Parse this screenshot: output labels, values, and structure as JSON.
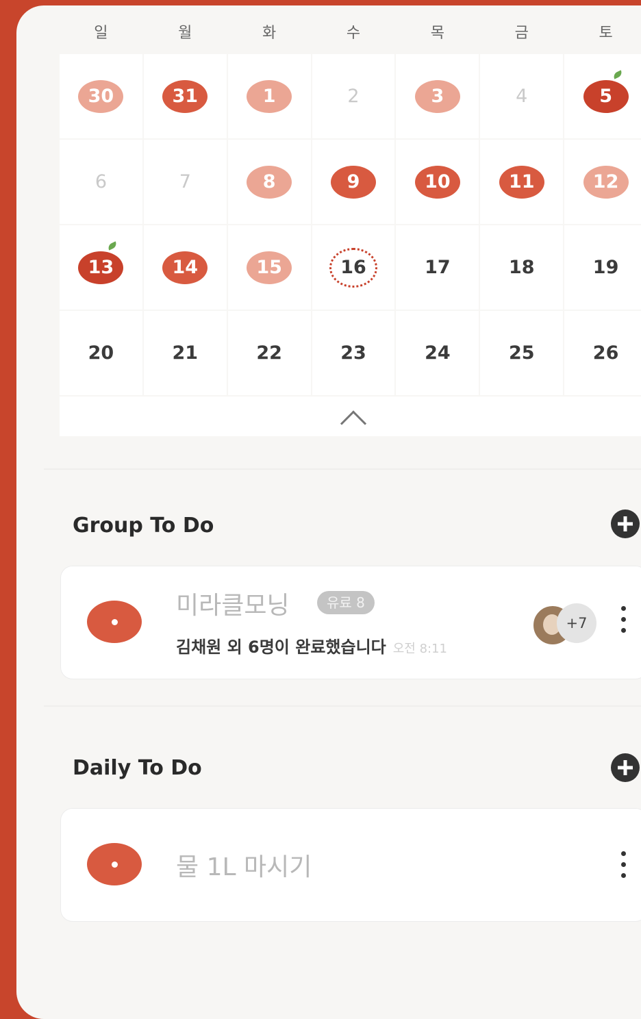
{
  "calendar": {
    "weekdays": [
      "일",
      "월",
      "화",
      "수",
      "목",
      "금",
      "토"
    ],
    "weeks": [
      [
        {
          "day": "30",
          "state": "light"
        },
        {
          "day": "31",
          "state": "full"
        },
        {
          "day": "1",
          "state": "light"
        },
        {
          "day": "2",
          "state": "past"
        },
        {
          "day": "3",
          "state": "light"
        },
        {
          "day": "4",
          "state": "past"
        },
        {
          "day": "5",
          "state": "dark",
          "leaf": true
        }
      ],
      [
        {
          "day": "6",
          "state": "past"
        },
        {
          "day": "7",
          "state": "past"
        },
        {
          "day": "8",
          "state": "light"
        },
        {
          "day": "9",
          "state": "full"
        },
        {
          "day": "10",
          "state": "full"
        },
        {
          "day": "11",
          "state": "full"
        },
        {
          "day": "12",
          "state": "light"
        }
      ],
      [
        {
          "day": "13",
          "state": "dark",
          "leaf": true
        },
        {
          "day": "14",
          "state": "full"
        },
        {
          "day": "15",
          "state": "light"
        },
        {
          "day": "16",
          "state": "today"
        },
        {
          "day": "17",
          "state": "future"
        },
        {
          "day": "18",
          "state": "future"
        },
        {
          "day": "19",
          "state": "future"
        }
      ],
      [
        {
          "day": "20",
          "state": "future"
        },
        {
          "day": "21",
          "state": "future"
        },
        {
          "day": "22",
          "state": "future"
        },
        {
          "day": "23",
          "state": "future"
        },
        {
          "day": "24",
          "state": "future"
        },
        {
          "day": "25",
          "state": "future"
        },
        {
          "day": "26",
          "state": "future"
        }
      ]
    ]
  },
  "group_todo": {
    "title": "Group To Do",
    "item": {
      "title": "미라클모닝",
      "badge": "유료 8",
      "completed_text": "김채원 외 6명이 완료했습니다",
      "time": "오전 8:11",
      "more_members": "+7"
    }
  },
  "daily_todo": {
    "title": "Daily To Do",
    "item": {
      "title": "물 1L 마시기"
    }
  },
  "colors": {
    "background": "#c8452c",
    "tomato": "#d85a40",
    "tomato_light": "#eba694",
    "panel": "#f7f6f4"
  }
}
